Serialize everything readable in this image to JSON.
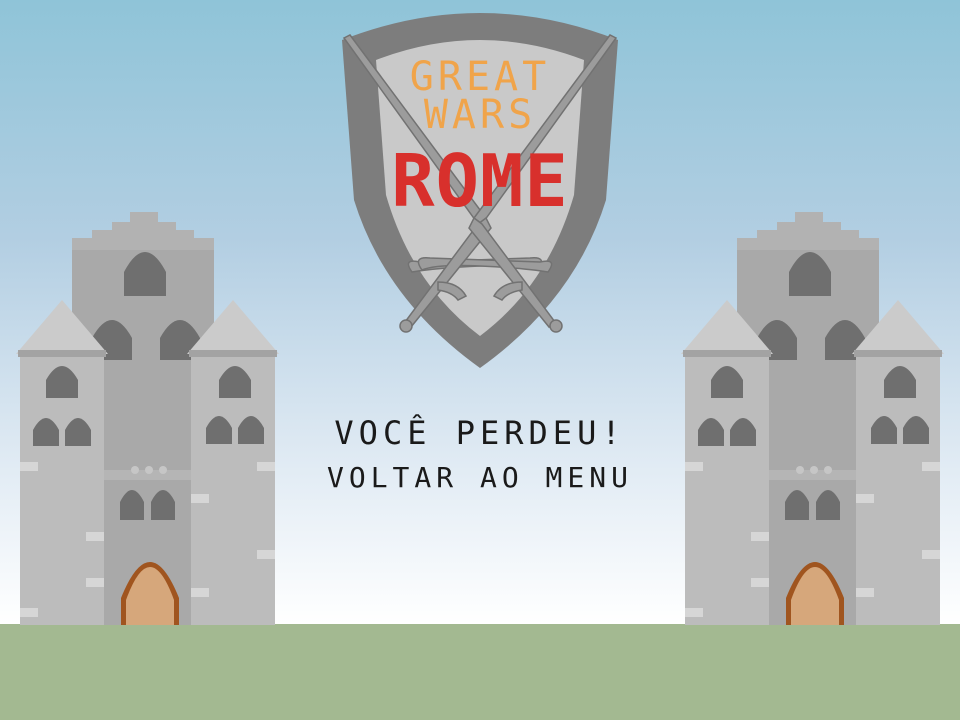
{
  "logo": {
    "line1": "GREAT",
    "line2": "WARS",
    "line3": "ROME",
    "line1_color": "#f0a44a",
    "line3_color": "#d8302c",
    "shield_outer": "#7d7d7d",
    "shield_inner": "#c9c9c9",
    "sword_color": "#9c9c9c"
  },
  "screen": {
    "result_text": "VOCÊ PERDEU!",
    "menu_button_label": "VOLTAR AO MENU"
  },
  "colors": {
    "castle_light": "#bcbcbc",
    "castle_mid": "#a9a9a9",
    "window": "#6f6f6f",
    "door": "#d6a77b",
    "door_frame": "#a0551f",
    "ground": "#a3b991"
  }
}
